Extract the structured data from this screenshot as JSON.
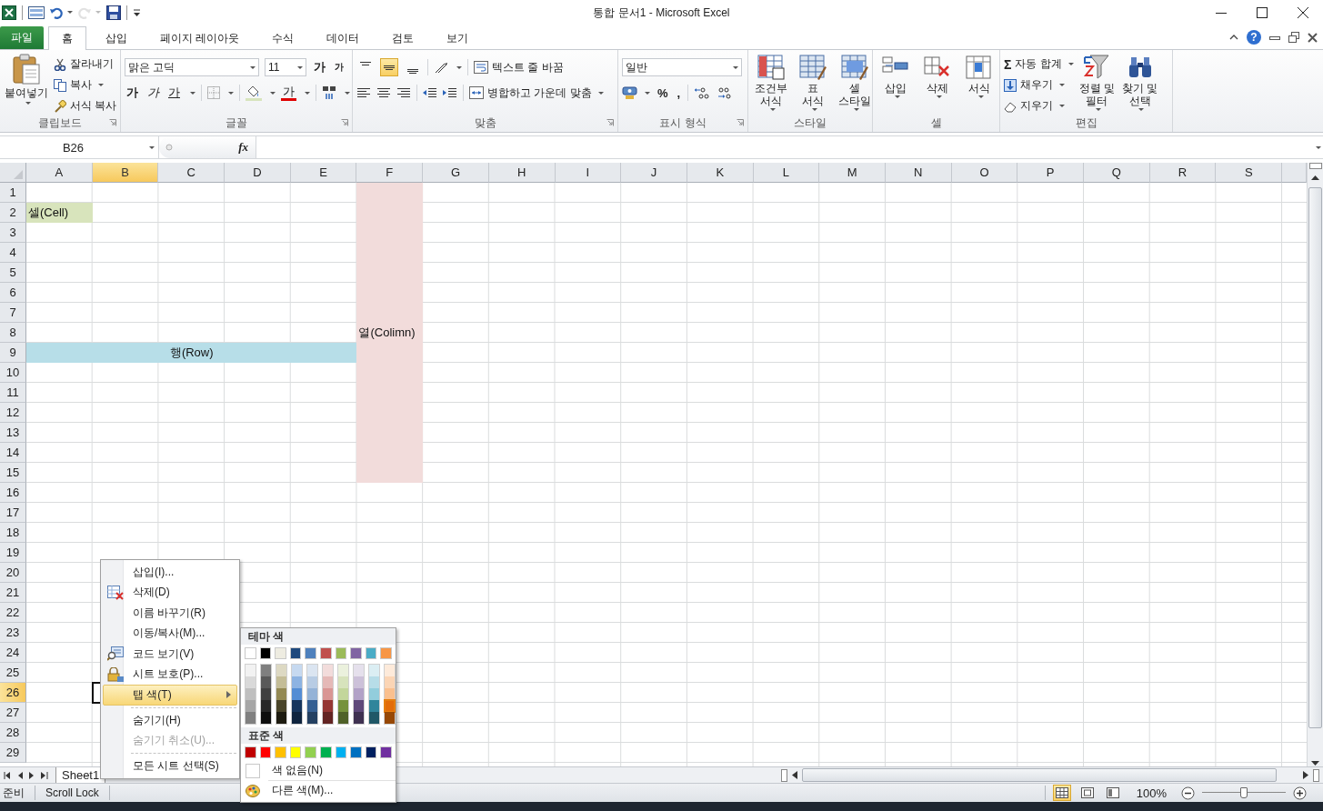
{
  "quick_access": [
    {
      "kind": "app",
      "disabled": false
    },
    {
      "kind": "form",
      "disabled": false
    },
    {
      "kind": "undo",
      "disabled": false
    },
    {
      "kind": "redo",
      "disabled": true
    },
    {
      "kind": "save",
      "disabled": false
    },
    {
      "kind": "customize",
      "disabled": false
    }
  ],
  "window": {
    "title": "통합 문서1 - Microsoft Excel",
    "help": "?"
  },
  "ribbon_tabs": [
    {
      "label": "파일",
      "kind": "file",
      "selected": false
    },
    {
      "label": "홈",
      "kind": "tab",
      "selected": true
    },
    {
      "label": "삽입",
      "kind": "tab",
      "selected": false
    },
    {
      "label": "페이지 레이아웃",
      "kind": "tab",
      "selected": false
    },
    {
      "label": "수식",
      "kind": "tab",
      "selected": false
    },
    {
      "label": "데이터",
      "kind": "tab",
      "selected": false
    },
    {
      "label": "검토",
      "kind": "tab",
      "selected": false
    },
    {
      "label": "보기",
      "kind": "tab",
      "selected": false
    }
  ],
  "clipboard": {
    "label": "클립보드",
    "paste": "붙여넣기",
    "cut": "잘라내기",
    "copy": "복사",
    "format_painter": "서식 복사"
  },
  "font": {
    "label": "글꼴",
    "name": "맑은 고딕",
    "size": "11",
    "grow": "가",
    "shrink": "가",
    "bold": "가",
    "italic": "가",
    "underline": "가",
    "font_color": "가"
  },
  "alignment": {
    "label": "맞춤",
    "vertical": [
      {
        "selected": false
      },
      {
        "selected": true
      },
      {
        "selected": false
      }
    ],
    "wrap": "텍스트 줄 바꿈",
    "merge": "병합하고 가운데 맞춤"
  },
  "number": {
    "label": "표시 형식",
    "format": "일반",
    "percent": "%",
    "comma": ","
  },
  "styles": {
    "label": "스타일",
    "commands": [
      {
        "lines": [
          "조건부",
          "서식"
        ]
      },
      {
        "lines": [
          "표",
          "서식"
        ]
      },
      {
        "lines": [
          "셀",
          "스타일"
        ]
      }
    ]
  },
  "cells": {
    "label": "셀",
    "commands": [
      {
        "lines": [
          "삽입"
        ]
      },
      {
        "lines": [
          "삭제"
        ]
      },
      {
        "lines": [
          "서식"
        ]
      }
    ]
  },
  "editing": {
    "label": "편집",
    "autosum_symbol": "Σ",
    "autosum": "자동 합계",
    "fill": "채우기",
    "clear": "지우기",
    "sort": [
      "정렬 및",
      "필터"
    ],
    "find": [
      "찾기 및",
      "선택"
    ]
  },
  "formula_bar": {
    "name_box": "B26",
    "fx": "fx"
  },
  "columns": [
    {
      "label": "A",
      "selected": false
    },
    {
      "label": "B",
      "selected": true
    },
    {
      "label": "C",
      "selected": false
    },
    {
      "label": "D",
      "selected": false
    },
    {
      "label": "E",
      "selected": false
    },
    {
      "label": "F",
      "selected": false
    },
    {
      "label": "G",
      "selected": false
    },
    {
      "label": "H",
      "selected": false
    },
    {
      "label": "I",
      "selected": false
    },
    {
      "label": "J",
      "selected": false
    },
    {
      "label": "K",
      "selected": false
    },
    {
      "label": "L",
      "selected": false
    },
    {
      "label": "M",
      "selected": false
    },
    {
      "label": "N",
      "selected": false
    },
    {
      "label": "O",
      "selected": false
    },
    {
      "label": "P",
      "selected": false
    },
    {
      "label": "Q",
      "selected": false
    },
    {
      "label": "R",
      "selected": false
    },
    {
      "label": "S",
      "selected": false
    }
  ],
  "rows": [
    {
      "label": "1",
      "selected": false,
      "cells": [
        null,
        null,
        null,
        null,
        null,
        {
          "color": "#f2dcdb"
        }
      ]
    },
    {
      "label": "2",
      "selected": false,
      "cells": [
        {
          "color": "#d8e4bc",
          "text": "셀(Cell)",
          "kind": "plain"
        },
        null,
        null,
        null,
        null,
        {
          "color": "#f2dcdb"
        }
      ]
    },
    {
      "label": "3",
      "selected": false,
      "cells": [
        null,
        null,
        null,
        null,
        null,
        {
          "color": "#f2dcdb"
        }
      ]
    },
    {
      "label": "4",
      "selected": false,
      "cells": [
        null,
        null,
        null,
        null,
        null,
        {
          "color": "#f2dcdb"
        }
      ]
    },
    {
      "label": "5",
      "selected": false,
      "cells": [
        null,
        null,
        null,
        null,
        null,
        {
          "color": "#f2dcdb"
        }
      ]
    },
    {
      "label": "6",
      "selected": false,
      "cells": [
        null,
        null,
        null,
        null,
        null,
        {
          "color": "#f2dcdb"
        }
      ]
    },
    {
      "label": "7",
      "selected": false,
      "cells": [
        null,
        null,
        null,
        null,
        null,
        {
          "color": "#f2dcdb"
        }
      ]
    },
    {
      "label": "8",
      "selected": false,
      "cells": [
        null,
        null,
        null,
        null,
        null,
        {
          "color": "#f2dcdb",
          "text": "열(Colimn)",
          "kind": "plain"
        }
      ]
    },
    {
      "label": "9",
      "selected": false,
      "cells": [
        {
          "color": "#b7dee8"
        },
        {
          "color": "#b7dee8"
        },
        {
          "color": "#b7dee8",
          "text": "행(Row)",
          "kind": "centered"
        },
        {
          "color": "#b7dee8"
        },
        {
          "color": "#b7dee8"
        },
        {
          "color": "#f2dcdb"
        }
      ]
    },
    {
      "label": "10",
      "selected": false,
      "cells": [
        null,
        null,
        null,
        null,
        null,
        {
          "color": "#f2dcdb"
        }
      ]
    },
    {
      "label": "11",
      "selected": false,
      "cells": [
        null,
        null,
        null,
        null,
        null,
        {
          "color": "#f2dcdb"
        }
      ]
    },
    {
      "label": "12",
      "selected": false,
      "cells": [
        null,
        null,
        null,
        null,
        null,
        {
          "color": "#f2dcdb"
        }
      ]
    },
    {
      "label": "13",
      "selected": false,
      "cells": [
        null,
        null,
        null,
        null,
        null,
        {
          "color": "#f2dcdb"
        }
      ]
    },
    {
      "label": "14",
      "selected": false,
      "cells": [
        null,
        null,
        null,
        null,
        null,
        {
          "color": "#f2dcdb"
        }
      ]
    },
    {
      "label": "15",
      "selected": false,
      "cells": [
        null,
        null,
        null,
        null,
        null,
        {
          "color": "#f2dcdb"
        }
      ]
    },
    {
      "label": "16",
      "selected": false
    },
    {
      "label": "17",
      "selected": false
    },
    {
      "label": "18",
      "selected": false
    },
    {
      "label": "19",
      "selected": false
    },
    {
      "label": "20",
      "selected": false
    },
    {
      "label": "21",
      "selected": false
    },
    {
      "label": "22",
      "selected": false
    },
    {
      "label": "23",
      "selected": false
    },
    {
      "label": "24",
      "selected": false
    },
    {
      "label": "25",
      "selected": false
    },
    {
      "label": "26",
      "selected": true
    },
    {
      "label": "27",
      "selected": false
    },
    {
      "label": "28",
      "selected": false
    },
    {
      "label": "29",
      "selected": false
    }
  ],
  "sheet_tabs": [
    {
      "label": "Sheet1",
      "selected": true
    }
  ],
  "status_bar": {
    "ready": "준비",
    "scroll_lock": "Scroll Lock",
    "views": [
      {
        "kind": "normal",
        "selected": true
      },
      {
        "kind": "page-layout",
        "selected": false
      },
      {
        "kind": "page-break",
        "selected": false
      }
    ],
    "zoom": "100%",
    "zoom_slider": {
      "level": 0.5
    }
  },
  "context_menu": [
    {
      "label": "삽입(I)...",
      "kind": "command",
      "disabled": false,
      "selected": false,
      "separator_before": false
    },
    {
      "label": "삭제(D)",
      "kind": "delete",
      "disabled": false,
      "selected": false,
      "separator_before": false
    },
    {
      "label": "이름 바꾸기(R)",
      "kind": "command",
      "disabled": false,
      "selected": false,
      "separator_before": false
    },
    {
      "label": "이동/복사(M)...",
      "kind": "command",
      "disabled": false,
      "selected": false,
      "separator_before": false
    },
    {
      "label": "코드 보기(V)",
      "kind": "view-code",
      "disabled": false,
      "selected": false,
      "separator_before": false
    },
    {
      "label": "시트 보호(P)...",
      "kind": "protect",
      "disabled": false,
      "selected": false,
      "separator_before": false
    },
    {
      "label": "탭 색(T)",
      "kind": "submenu",
      "disabled": false,
      "selected": true,
      "separator_before": false
    },
    {
      "label": "숨기기(H)",
      "kind": "command",
      "disabled": false,
      "selected": false,
      "separator_before": true
    },
    {
      "label": "숨기기 취소(U)...",
      "kind": "command",
      "disabled": true,
      "selected": false,
      "separator_before": false
    },
    {
      "label": "모든 시트 선택(S)",
      "kind": "command",
      "disabled": false,
      "selected": false,
      "separator_before": true
    }
  ],
  "color_menu": {
    "theme_title": "테마 색",
    "theme": [
      {
        "color": "#ffffff",
        "selected": false,
        "shades": [
          {
            "color": "#f2f2f2",
            "selected": false
          },
          {
            "color": "#d9d9d9",
            "selected": false
          },
          {
            "color": "#bfbfbf",
            "selected": false
          },
          {
            "color": "#a6a6a6",
            "selected": false
          },
          {
            "color": "#808080",
            "selected": false
          }
        ]
      },
      {
        "color": "#000000",
        "selected": false,
        "shades": [
          {
            "color": "#7f7f7f",
            "selected": false
          },
          {
            "color": "#595959",
            "selected": false
          },
          {
            "color": "#404040",
            "selected": false
          },
          {
            "color": "#262626",
            "selected": false
          },
          {
            "color": "#0d0d0d",
            "selected": false
          }
        ]
      },
      {
        "color": "#eeece1",
        "selected": false,
        "shades": [
          {
            "color": "#ddd9c3",
            "selected": false
          },
          {
            "color": "#c4bd97",
            "selected": false
          },
          {
            "color": "#938953",
            "selected": false
          },
          {
            "color": "#494429",
            "selected": false
          },
          {
            "color": "#1d1b10",
            "selected": false
          }
        ]
      },
      {
        "color": "#1f497d",
        "selected": false,
        "shades": [
          {
            "color": "#c6d9f0",
            "selected": false
          },
          {
            "color": "#8db3e2",
            "selected": false
          },
          {
            "color": "#548dd4",
            "selected": false
          },
          {
            "color": "#17365d",
            "selected": false
          },
          {
            "color": "#0f243e",
            "selected": false
          }
        ]
      },
      {
        "color": "#4f81bd",
        "selected": false,
        "shades": [
          {
            "color": "#dbe5f1",
            "selected": false
          },
          {
            "color": "#b8cce4",
            "selected": false
          },
          {
            "color": "#95b3d7",
            "selected": false
          },
          {
            "color": "#366092",
            "selected": false
          },
          {
            "color": "#244061",
            "selected": false
          }
        ]
      },
      {
        "color": "#c0504d",
        "selected": false,
        "shades": [
          {
            "color": "#f2dcdb",
            "selected": false
          },
          {
            "color": "#e5b9b7",
            "selected": false
          },
          {
            "color": "#d99694",
            "selected": false
          },
          {
            "color": "#953734",
            "selected": false
          },
          {
            "color": "#632423",
            "selected": false
          }
        ]
      },
      {
        "color": "#9bbb59",
        "selected": false,
        "shades": [
          {
            "color": "#ebf1dd",
            "selected": false
          },
          {
            "color": "#d7e3bc",
            "selected": false
          },
          {
            "color": "#c3d69b",
            "selected": false
          },
          {
            "color": "#76923c",
            "selected": false
          },
          {
            "color": "#4f6128",
            "selected": false
          }
        ]
      },
      {
        "color": "#8064a2",
        "selected": false,
        "shades": [
          {
            "color": "#e5e0ec",
            "selected": false
          },
          {
            "color": "#ccc1d9",
            "selected": false
          },
          {
            "color": "#b2a2c7",
            "selected": false
          },
          {
            "color": "#5f497a",
            "selected": false
          },
          {
            "color": "#3f3151",
            "selected": false
          }
        ]
      },
      {
        "color": "#4bacc6",
        "selected": false,
        "shades": [
          {
            "color": "#dbeef3",
            "selected": false
          },
          {
            "color": "#b7dde8",
            "selected": false
          },
          {
            "color": "#92cddc",
            "selected": false
          },
          {
            "color": "#31859b",
            "selected": false
          },
          {
            "color": "#205867",
            "selected": false
          }
        ]
      },
      {
        "color": "#f79646",
        "selected": false,
        "shades": [
          {
            "color": "#fdeada",
            "selected": false
          },
          {
            "color": "#fbd5b5",
            "selected": false
          },
          {
            "color": "#fac08f",
            "selected": false
          },
          {
            "color": "#e36c09",
            "selected": true
          },
          {
            "color": "#974806",
            "selected": false
          }
        ]
      }
    ],
    "standard_title": "표준 색",
    "standard": [
      {
        "color": "#c00000",
        "selected": false
      },
      {
        "color": "#ff0000",
        "selected": false
      },
      {
        "color": "#ffc000",
        "selected": false
      },
      {
        "color": "#ffff00",
        "selected": false
      },
      {
        "color": "#92d050",
        "selected": false
      },
      {
        "color": "#00b050",
        "selected": false
      },
      {
        "color": "#00b0f0",
        "selected": false
      },
      {
        "color": "#0070c0",
        "selected": false
      },
      {
        "color": "#002060",
        "selected": false
      },
      {
        "color": "#7030a0",
        "selected": false
      }
    ],
    "no_color": "색 없음(N)",
    "more_colors": "다른 색(M)..."
  }
}
